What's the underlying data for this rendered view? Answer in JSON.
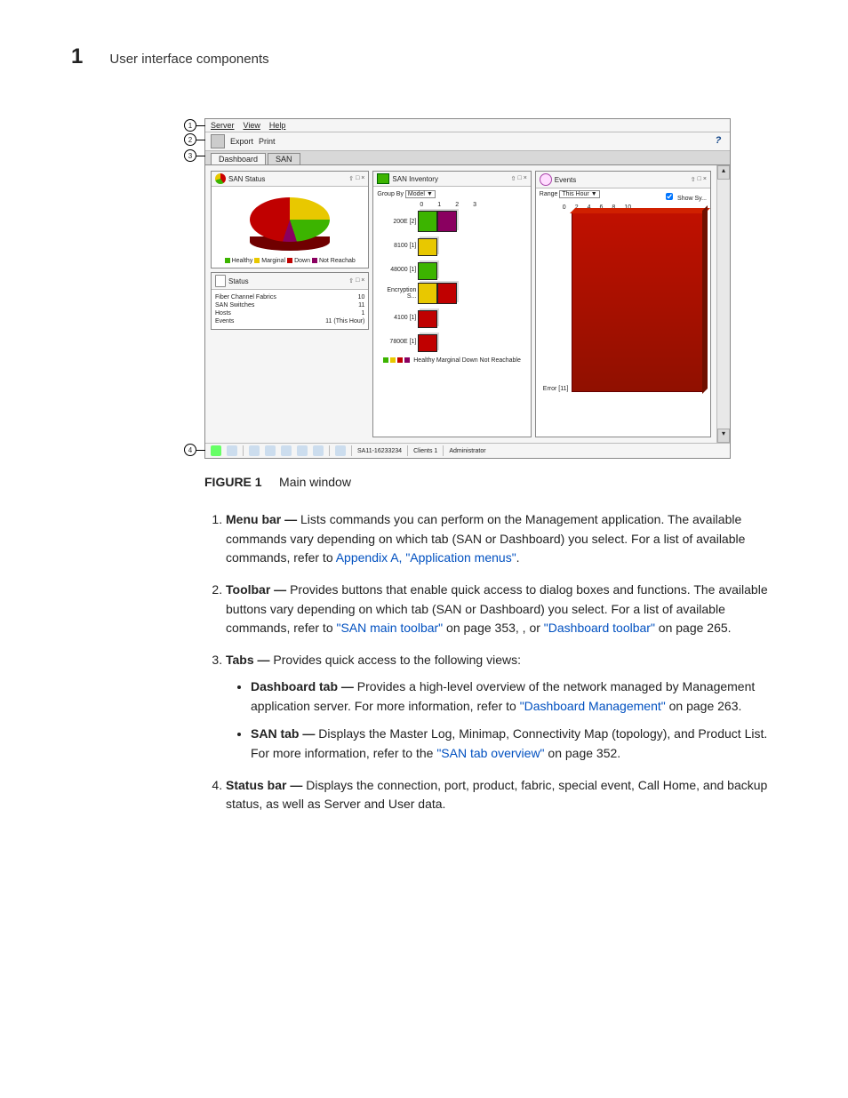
{
  "header": {
    "chapter_number": "1",
    "section_title": "User interface components"
  },
  "screenshot": {
    "menubar": {
      "items": [
        "Server",
        "View",
        "Help"
      ]
    },
    "toolbar": {
      "export": "Export",
      "print": "Print"
    },
    "tabs": {
      "dashboard": "Dashboard",
      "san": "SAN"
    },
    "san_status": {
      "title": "SAN Status",
      "legend": {
        "healthy": "Healthy",
        "marginal": "Marginal",
        "down": "Down",
        "not_reachable": "Not Reachab"
      }
    },
    "status_panel": {
      "title": "Status",
      "rows": [
        {
          "label": "Fiber Channel Fabrics",
          "value": "10"
        },
        {
          "label": "SAN Switches",
          "value": "11"
        },
        {
          "label": "Hosts",
          "value": "1"
        },
        {
          "label": "Events",
          "value": "11 (This Hour)"
        }
      ]
    },
    "inventory": {
      "title": "SAN Inventory",
      "group_by_label": "Group By",
      "group_by_value": "Model",
      "axis": [
        "0",
        "1",
        "2",
        "3"
      ],
      "rows": [
        {
          "label": "200E [2]"
        },
        {
          "label": "8100 [1]"
        },
        {
          "label": "48000 [1]"
        },
        {
          "label": "Encryption S..."
        },
        {
          "label": "4100 [1]"
        },
        {
          "label": "7800E [1]"
        }
      ],
      "legend": "Healthy  Marginal  Down  Not Reachable"
    },
    "events": {
      "title": "Events",
      "range_label": "Range",
      "range_value": "This Hour",
      "show_label": "Show Sy...",
      "axis": [
        "0",
        "2",
        "4",
        "6",
        "8",
        "10"
      ],
      "row_label": "Error [11]"
    },
    "statusbar": {
      "server": "SA11-16233234",
      "clients": "Clients  1",
      "user": "Administrator"
    }
  },
  "figure": {
    "label": "FIGURE 1",
    "title": "Main window"
  },
  "callouts": {
    "c1": "1",
    "c2": "2",
    "c3": "3",
    "c4": "4"
  },
  "descriptions": {
    "menu_bar_term": "Menu bar —",
    "menu_bar_text": " Lists commands you can perform on the Management application. The available commands vary depending on which tab (SAN or Dashboard) you select. For a list of available commands, refer to ",
    "menu_bar_link": "Appendix A, \"Application menus\"",
    "toolbar_term": "Toolbar —",
    "toolbar_text": " Provides buttons that enable quick access to dialog boxes and functions. The available buttons vary depending on which tab (SAN or Dashboard) you select. For a list of available commands, refer to ",
    "toolbar_link1": "\"SAN main toolbar\"",
    "toolbar_page1": " on page 353, , or ",
    "toolbar_link2": "\"Dashboard toolbar\"",
    "toolbar_page2": " on page 265.",
    "tabs_term": "Tabs —",
    "tabs_text": " Provides quick access to the following views:",
    "dash_tab_term": "Dashboard tab —",
    "dash_tab_text": " Provides a high-level overview of the network managed by Management application server. For more information, refer to ",
    "dash_tab_link": "\"Dashboard Management\"",
    "dash_tab_page": " on page 263.",
    "san_tab_term": "SAN tab —",
    "san_tab_text": " Displays the Master Log, Minimap, Connectivity Map (topology), and Product List. For more information, refer to the ",
    "san_tab_link": "\"SAN tab overview\"",
    "san_tab_page": " on page 352.",
    "status_bar_term": "Status bar —",
    "status_bar_text": " Displays the connection, port, product, fabric, special event, Call Home, and backup status, as well as Server and User data."
  },
  "chart_data": {
    "san_status_pie": {
      "type": "pie",
      "title": "SAN Status",
      "categories": [
        "Healthy",
        "Marginal",
        "Down",
        "Not Reachable"
      ],
      "values": [
        3,
        3,
        4,
        1
      ]
    },
    "san_inventory_bars": {
      "type": "bar",
      "title": "SAN Inventory",
      "group_by": "Model",
      "xlim": [
        0,
        3
      ],
      "categories": [
        "200E [2]",
        "8100 [1]",
        "48000 [1]",
        "Encryption S...",
        "4100 [1]",
        "7800E [1]"
      ],
      "series": [
        {
          "name": "Healthy",
          "values": [
            1,
            0,
            1,
            0,
            0,
            0
          ]
        },
        {
          "name": "Marginal",
          "values": [
            0,
            1,
            0,
            1,
            0,
            0
          ]
        },
        {
          "name": "Down",
          "values": [
            0,
            0,
            0,
            1,
            1,
            1
          ]
        },
        {
          "name": "Not Reachable",
          "values": [
            1,
            0,
            0,
            0,
            0,
            0
          ]
        }
      ]
    },
    "events_bar": {
      "type": "bar",
      "title": "Events",
      "range": "This Hour",
      "xlim": [
        0,
        10
      ],
      "categories": [
        "Error [11]"
      ],
      "values": [
        11
      ]
    }
  }
}
